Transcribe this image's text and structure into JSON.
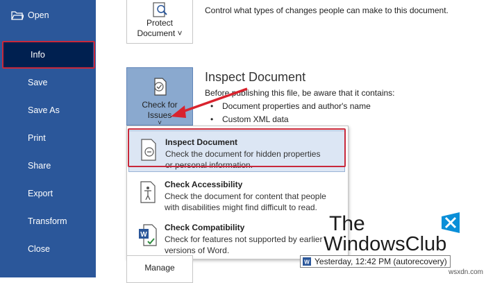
{
  "sidebar": {
    "items": [
      {
        "label": "Open",
        "icon": "folder-open-icon"
      },
      {
        "label": "Info",
        "active": true
      },
      {
        "label": "Save"
      },
      {
        "label": "Save As"
      },
      {
        "label": "Print"
      },
      {
        "label": "Share"
      },
      {
        "label": "Export"
      },
      {
        "label": "Transform"
      },
      {
        "label": "Close"
      }
    ],
    "background_color": "#2b579a",
    "active_color": "#002050",
    "highlight_color": "#c8283a"
  },
  "protect": {
    "tile_line1": "Protect",
    "tile_line2": "Document ˅",
    "description": "Control what types of changes people can make to this document."
  },
  "inspect": {
    "tile_line1": "Check for",
    "tile_line2": "Issues",
    "tile_chevron": "˅",
    "title": "Inspect Document",
    "intro": "Before publishing this file, be aware that it contains:",
    "bullets": [
      "Document properties and author's name",
      "Custom XML data"
    ]
  },
  "dropdown": {
    "items": [
      {
        "title": "Inspect Document",
        "desc_line1": "Check the document for hidden properties",
        "desc_line2": "or personal information."
      },
      {
        "title": "Check Accessibility",
        "desc_line1": "Check the document for content that people",
        "desc_line2": "with disabilities might find difficult to read."
      },
      {
        "title": "Check Compatibility",
        "desc_line1": "Check for features not supported by earlier",
        "desc_line2": "versions of Word."
      }
    ]
  },
  "manage": {
    "tile_label": "Manage"
  },
  "recovery": {
    "label": "Yesterday, 12:42 PM (autorecovery)"
  },
  "watermark": {
    "line1": "The",
    "line2": "WindowsClub"
  },
  "source": {
    "label": "wsxdn.com"
  }
}
